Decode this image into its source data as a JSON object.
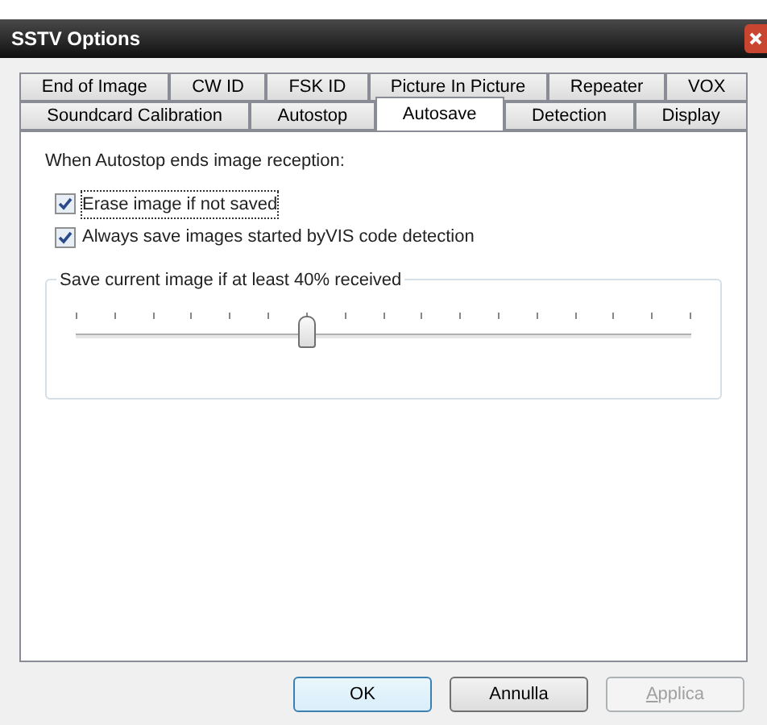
{
  "window": {
    "title": "SSTV Options"
  },
  "tab_rows": [
    [
      {
        "label": "End of Image",
        "selected": false
      },
      {
        "label": "CW ID",
        "selected": false
      },
      {
        "label": "FSK ID",
        "selected": false
      },
      {
        "label": "Picture In Picture",
        "selected": false
      },
      {
        "label": "Repeater",
        "selected": false
      },
      {
        "label": "VOX",
        "selected": false
      }
    ],
    [
      {
        "label": "Soundcard Calibration",
        "selected": false
      },
      {
        "label": "Autostop",
        "selected": false
      },
      {
        "label": "Autosave",
        "selected": true
      },
      {
        "label": "Detection",
        "selected": false
      },
      {
        "label": "Display",
        "selected": false
      }
    ]
  ],
  "intro": "When Autostop ends image reception:",
  "checkboxes": [
    {
      "label": "Erase image if not saved",
      "checked": true,
      "focused": true
    },
    {
      "label": "Always save images started byVIS code detection",
      "checked": true,
      "focused": false
    }
  ],
  "group": {
    "title": "Save current image if at least 40% received",
    "slider": {
      "level": 0.375
    }
  },
  "buttons": [
    {
      "label": "OK",
      "default": true,
      "disabled": false
    },
    {
      "label": "Annulla",
      "default": false,
      "disabled": false
    },
    {
      "label": "Applica",
      "default": false,
      "disabled": true,
      "mnemonic": true
    }
  ]
}
